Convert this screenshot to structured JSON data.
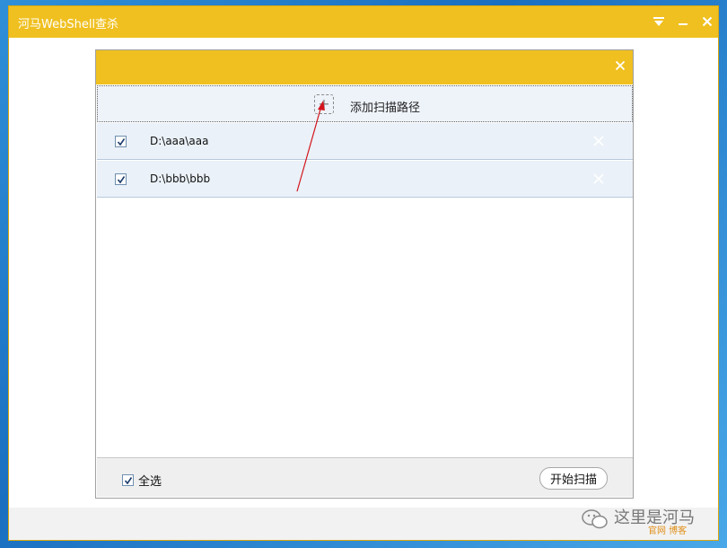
{
  "app": {
    "title": "河马WebShell查杀"
  },
  "dialog": {
    "add_path_label": "添加扫描路径",
    "add_icon": "plus-icon",
    "paths": [
      {
        "path": "D:\\aaa\\aaa",
        "checked": true
      },
      {
        "path": "D:\\bbb\\bbb",
        "checked": true
      }
    ],
    "select_all_label": "全选",
    "start_scan_label": "开始扫描"
  },
  "watermark": {
    "text": "这里是河马",
    "sub": "官网 博客"
  },
  "colors": {
    "title_bar": "#f0c020",
    "row_bg": "#eaf1f8",
    "annotation_arrow": "#d4141c"
  }
}
